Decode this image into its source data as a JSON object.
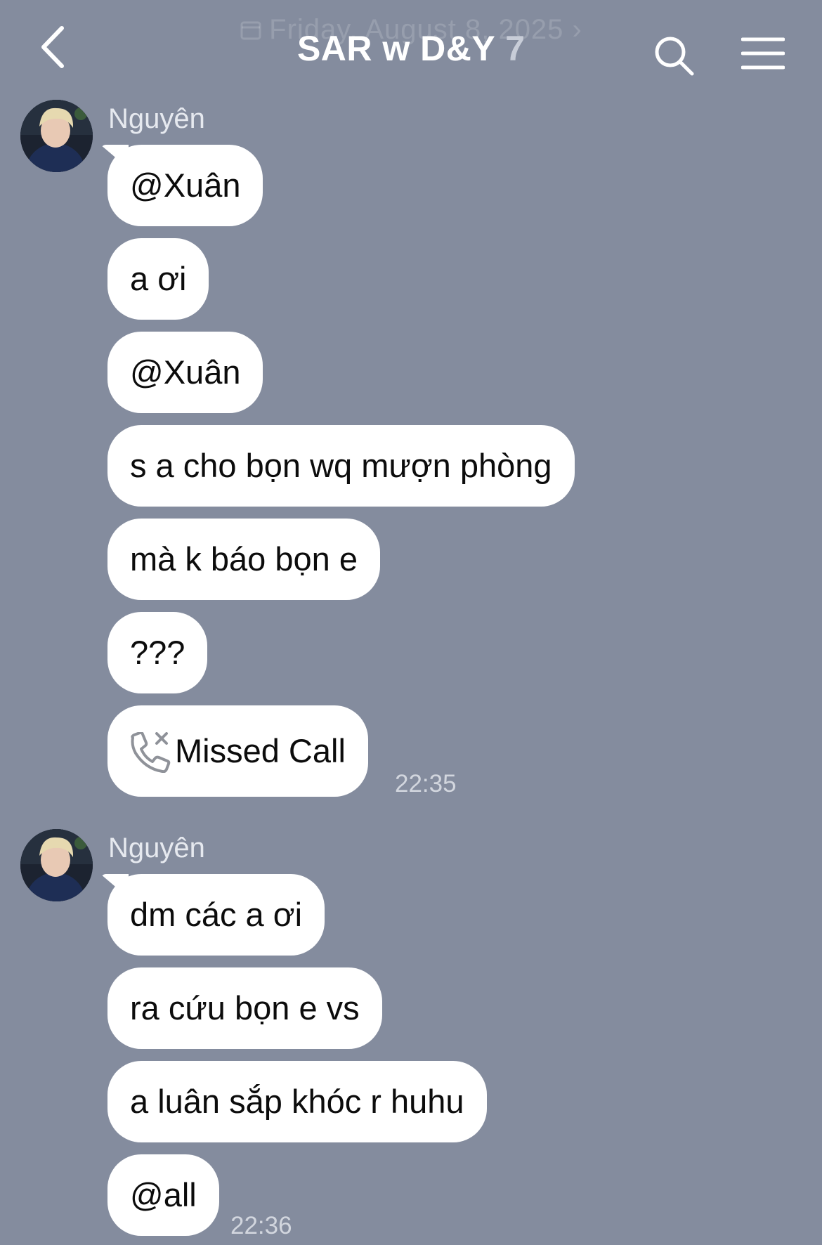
{
  "header": {
    "date_ghost": "Friday, August 8, 2025 ›",
    "title": "SAR w D&Y",
    "member_count": "7",
    "back_icon": "chevron-left-icon",
    "search_icon": "search-icon",
    "menu_icon": "menu-icon"
  },
  "colors": {
    "background": "#848c9e",
    "bubble": "#ffffff",
    "text": "#0c0c0c"
  },
  "messages": [
    {
      "sender": "Nguyên",
      "bubbles": [
        "@Xuân",
        "a ơi",
        "@Xuân",
        "s a cho bọn wq mượn phòng",
        "mà k báo bọn e",
        "???"
      ],
      "missed_call": "Missed Call",
      "time": "22:35"
    },
    {
      "sender": "Nguyên",
      "bubbles": [
        "dm các a ơi",
        "ra cứu bọn e vs",
        "a luân sắp khóc r huhu",
        "@all"
      ],
      "time": "22:36"
    }
  ]
}
